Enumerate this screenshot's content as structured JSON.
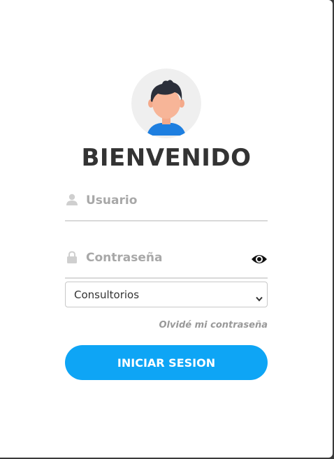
{
  "login": {
    "title": "BIENVENIDO",
    "username_placeholder": "Usuario",
    "password_placeholder": "Contraseña",
    "location_select_value": "Consultorios",
    "location_options": [
      "Consultorios"
    ],
    "forgot_password_label": "Olvidé mi contraseña",
    "submit_label": "INICIAR SESION"
  },
  "icons": {
    "avatar": "user-avatar-icon",
    "username": "user-icon",
    "password": "lock-icon",
    "show_password": "eye-icon",
    "select_arrow": "chevron-down-icon"
  },
  "colors": {
    "accent": "#0ea5f5",
    "title": "#333333",
    "placeholder": "#a8a8a8",
    "link": "#999999"
  }
}
